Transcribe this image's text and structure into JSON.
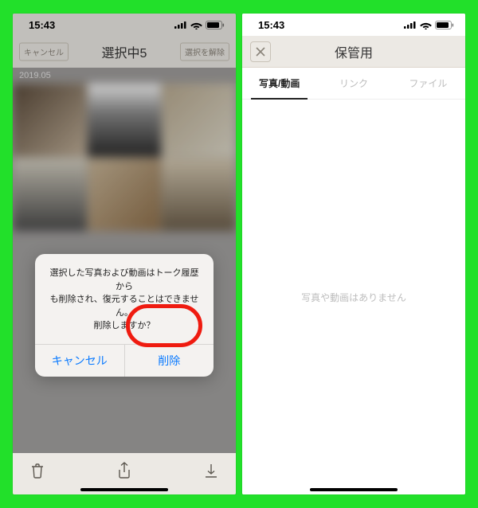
{
  "status": {
    "time": "15:43"
  },
  "left": {
    "nav": {
      "cancel": "キャンセル",
      "title": "選択中5",
      "deselect": "選択を解除"
    },
    "date_label": "2019.05",
    "dialog": {
      "line1": "選択した写真および動画はトーク履歴から",
      "line2": "も削除され、復元することはできません。",
      "line3": "削除しますか？",
      "cancel": "キャンセル",
      "delete": "削除"
    }
  },
  "right": {
    "nav": {
      "title": "保管用"
    },
    "tabs": {
      "t1": "写真/動画",
      "t2": "リンク",
      "t3": "ファイル"
    },
    "empty": "写真や動画はありません"
  }
}
